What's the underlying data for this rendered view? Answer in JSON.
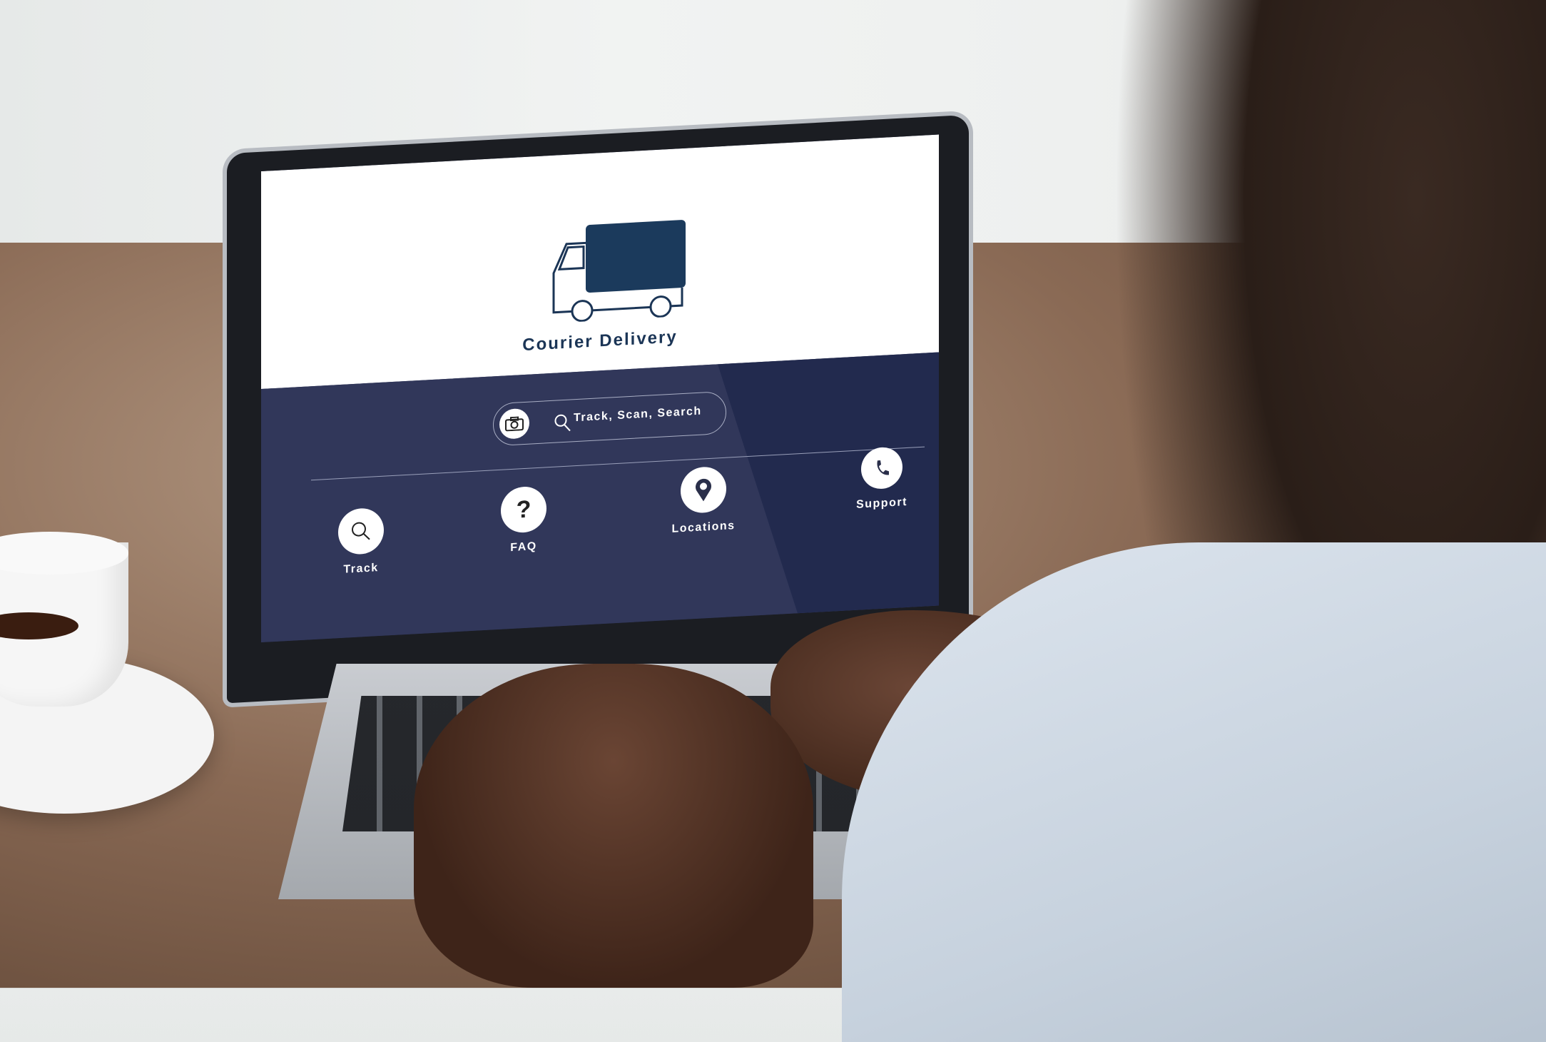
{
  "app": {
    "brand_title": "Courier Delivery",
    "logo_icon": "truck-icon",
    "accent_color": "#1b3556",
    "header_background": "#ffffff",
    "body_background": "#31375a"
  },
  "search": {
    "camera_icon": "camera-icon",
    "search_icon": "search-icon",
    "placeholder": "Track, Scan, Search"
  },
  "nav": [
    {
      "label": "Track",
      "icon": "search-icon"
    },
    {
      "label": "FAQ",
      "icon": "question-icon"
    },
    {
      "label": "Locations",
      "icon": "map-pin-icon"
    },
    {
      "label": "Support",
      "icon": "phone-icon"
    }
  ]
}
